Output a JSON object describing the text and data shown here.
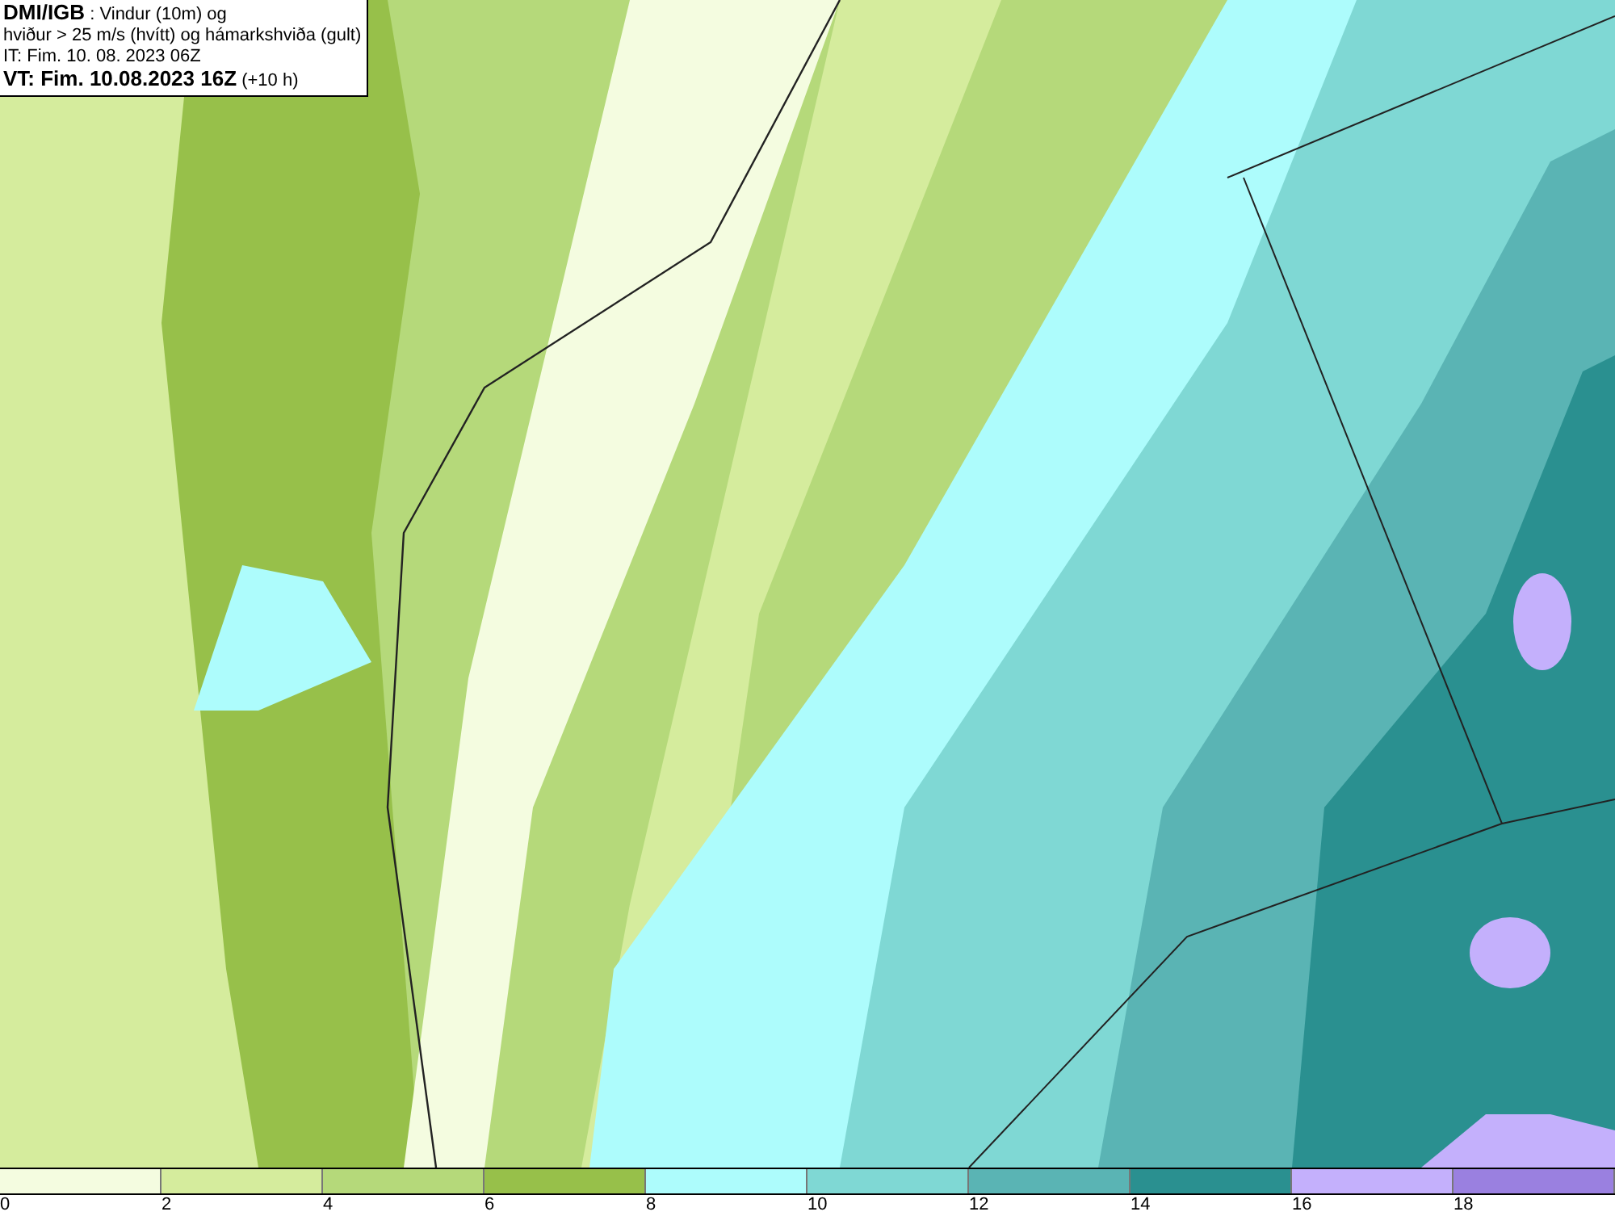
{
  "header": {
    "source": "DMI/IGB",
    "title": ": Vindur (10m) og",
    "subtitle": "hviður > 25 m/s (hvítt) og hámarkshviða (gult)",
    "initial_time": "IT: Fim. 10. 08. 2023 06Z",
    "valid_time": "VT: Fim. 10.08.2023 16Z",
    "lead": "(+10 h)"
  },
  "legend": [
    {
      "label": "0",
      "color": "#f4fce0"
    },
    {
      "label": "2",
      "color": "#d5ec9d"
    },
    {
      "label": "4",
      "color": "#b5d97a"
    },
    {
      "label": "6",
      "color": "#97c04a"
    },
    {
      "label": "8",
      "color": "#adfcfc"
    },
    {
      "label": "10",
      "color": "#7fd8d4"
    },
    {
      "label": "12",
      "color": "#5ab4b4"
    },
    {
      "label": "14",
      "color": "#2a9090"
    },
    {
      "label": "16",
      "color": "#c4b0fc"
    },
    {
      "label": "18",
      "color": "#9a80e0"
    }
  ]
}
